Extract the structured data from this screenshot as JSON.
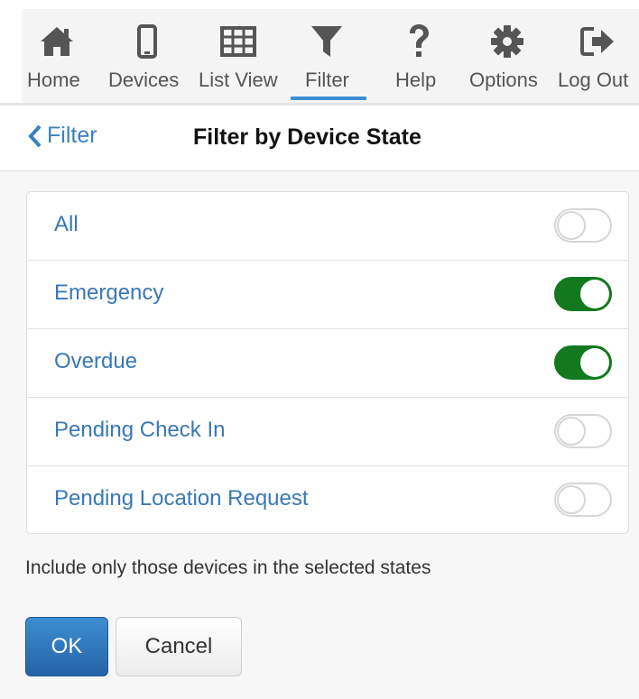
{
  "toolbar": {
    "items": [
      {
        "label": "Home",
        "icon": "home-icon"
      },
      {
        "label": "Devices",
        "icon": "mobile-icon"
      },
      {
        "label": "List View",
        "icon": "grid-icon"
      },
      {
        "label": "Filter",
        "icon": "filter-icon",
        "active": true
      },
      {
        "label": "Help",
        "icon": "question-icon"
      },
      {
        "label": "Options",
        "icon": "gear-icon"
      },
      {
        "label": "Log Out",
        "icon": "logout-icon"
      }
    ],
    "icon_color": "#555555",
    "active_color": "#3a8ed6"
  },
  "header": {
    "back_label": "Filter",
    "title": "Filter by Device State"
  },
  "filters": [
    {
      "label": "All",
      "on": false
    },
    {
      "label": "Emergency",
      "on": true
    },
    {
      "label": "Overdue",
      "on": true
    },
    {
      "label": "Pending Check In",
      "on": false
    },
    {
      "label": "Pending Location Request",
      "on": false
    }
  ],
  "help_text": "Include only those devices in the selected states",
  "buttons": {
    "ok": "OK",
    "cancel": "Cancel"
  },
  "colors": {
    "toggle_on": "#12791f",
    "link": "#3878b8",
    "primary_button": "#2e74bb"
  }
}
